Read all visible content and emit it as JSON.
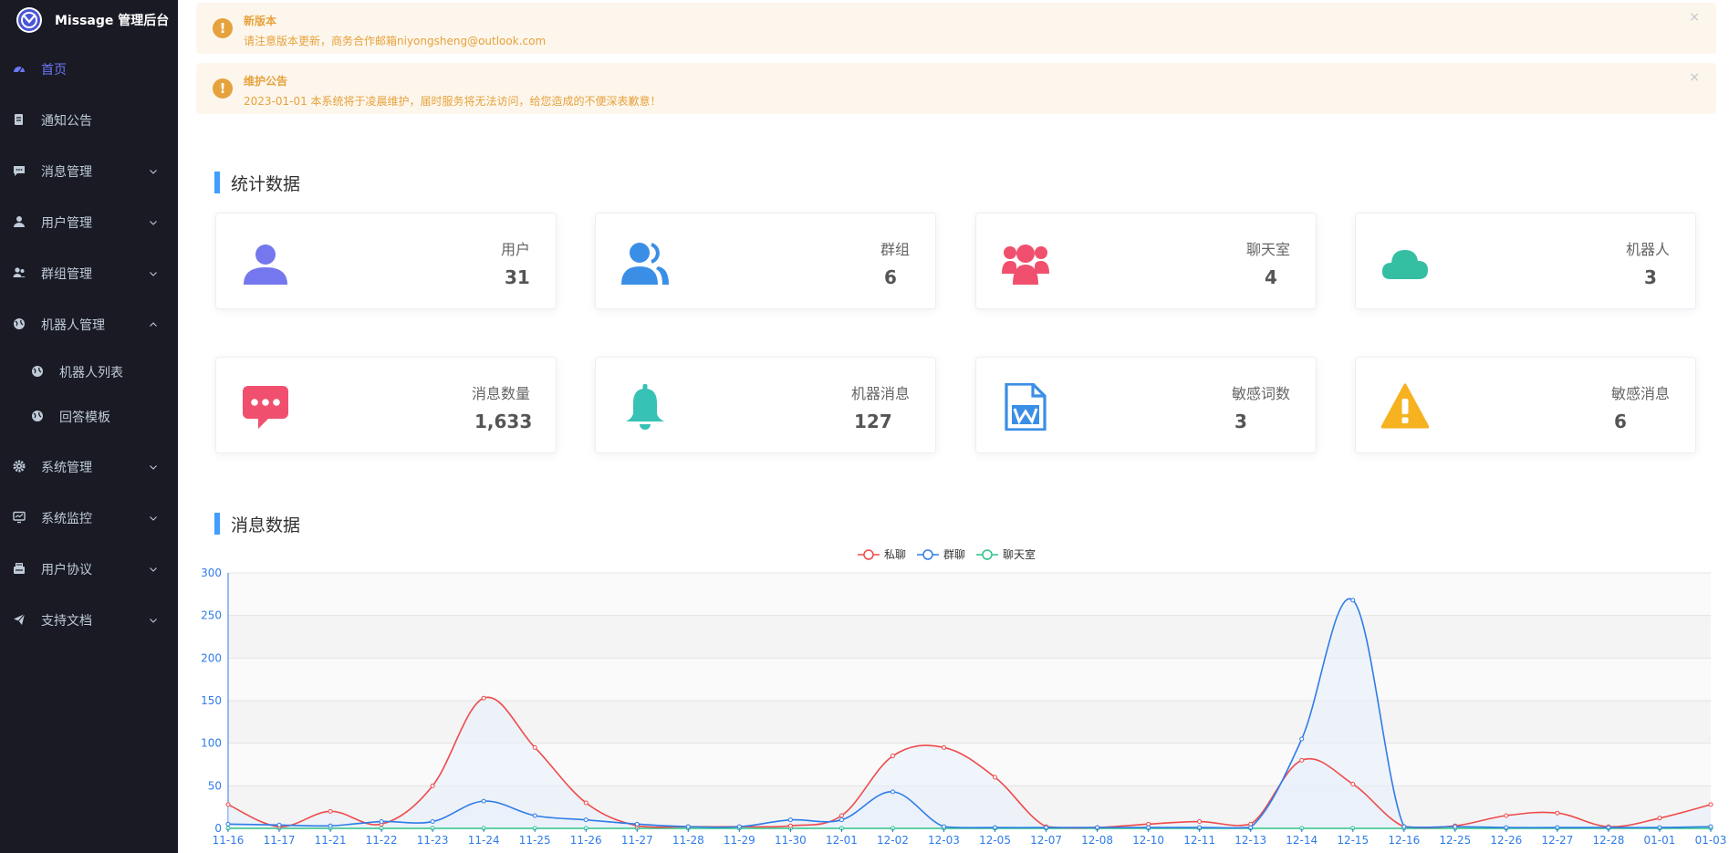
{
  "app": {
    "title": "Missage 管理后台"
  },
  "sidebar": {
    "items": [
      {
        "label": "首页",
        "icon": "dashboard-icon",
        "active": true
      },
      {
        "label": "通知公告",
        "icon": "notice-icon"
      },
      {
        "label": "消息管理",
        "icon": "message-icon",
        "expandable": true
      },
      {
        "label": "用户管理",
        "icon": "user-icon",
        "expandable": true
      },
      {
        "label": "群组管理",
        "icon": "group-icon",
        "expandable": true
      },
      {
        "label": "机器人管理",
        "icon": "globe-icon",
        "expandable": true,
        "expanded": true
      },
      {
        "label": "机器人列表",
        "icon": "globe-icon",
        "sub": true
      },
      {
        "label": "回答模板",
        "icon": "globe-icon",
        "sub": true
      },
      {
        "label": "系统管理",
        "icon": "gear-icon",
        "expandable": true
      },
      {
        "label": "系统监控",
        "icon": "monitor-icon",
        "expandable": true
      },
      {
        "label": "用户协议",
        "icon": "agreement-icon",
        "expandable": true
      },
      {
        "label": "支持文档",
        "icon": "paper-plane-icon",
        "expandable": true
      }
    ]
  },
  "alerts": [
    {
      "title": "新版本",
      "description": "请注意版本更新，商务合作邮箱niyongsheng@outlook.com",
      "close": "×"
    },
    {
      "title": "维护公告",
      "description": "2023-01-01 本系统将于凌晨维护，届时服务将无法访问，给您造成的不便深表歉意！",
      "close": "×"
    }
  ],
  "stats_section": {
    "title": "统计数据"
  },
  "stats": [
    {
      "label": "用户",
      "value": "31",
      "icon": "user-icon",
      "color": "#7577ee"
    },
    {
      "label": "群组",
      "value": "6",
      "icon": "users-icon",
      "color": "#3a8ee6"
    },
    {
      "label": "聊天室",
      "value": "4",
      "icon": "people-group-icon",
      "color": "#f0506e"
    },
    {
      "label": "机器人",
      "value": "3",
      "icon": "cloud-icon",
      "color": "#34bfa3"
    },
    {
      "label": "消息数量",
      "value": "1,633",
      "icon": "chat-bubble-icon",
      "color": "#f0506e"
    },
    {
      "label": "机器消息",
      "value": "127",
      "icon": "bell-icon",
      "color": "#36c2b4"
    },
    {
      "label": "敏感词数",
      "value": "3",
      "icon": "word-file-icon",
      "color": "#3a8ee6"
    },
    {
      "label": "敏感消息",
      "value": "6",
      "icon": "warning-icon",
      "color": "#f6b21f"
    }
  ],
  "messages_section": {
    "title": "消息数据"
  },
  "chart_data": {
    "type": "line",
    "categories": [
      "11-16",
      "11-17",
      "11-21",
      "11-22",
      "11-23",
      "11-24",
      "11-25",
      "11-26",
      "11-27",
      "11-28",
      "11-29",
      "11-30",
      "12-01",
      "12-02",
      "12-03",
      "12-05",
      "12-07",
      "12-08",
      "12-10",
      "12-11",
      "12-13",
      "12-14",
      "12-15",
      "12-16",
      "12-25",
      "12-26",
      "12-27",
      "12-28",
      "01-01",
      "01-03"
    ],
    "series": [
      {
        "name": "私聊",
        "color": "#ee4b4b",
        "values": [
          28,
          2,
          20,
          5,
          50,
          153,
          95,
          30,
          3,
          2,
          2,
          3,
          15,
          85,
          95,
          60,
          2,
          1,
          5,
          8,
          5,
          80,
          52,
          2,
          3,
          15,
          18,
          2,
          12,
          28
        ]
      },
      {
        "name": "群聊",
        "color": "#2f7ce8",
        "area": true,
        "values": [
          5,
          4,
          3,
          8,
          8,
          32,
          15,
          10,
          5,
          2,
          2,
          10,
          10,
          43,
          2,
          1,
          1,
          1,
          1,
          1,
          1,
          105,
          268,
          2,
          2,
          1,
          1,
          1,
          1,
          2
        ]
      },
      {
        "name": "聊天室",
        "color": "#2ec486",
        "values": [
          0,
          0,
          0,
          0,
          0,
          0,
          0,
          0,
          0,
          0,
          0,
          0,
          0,
          0,
          0,
          0,
          0,
          0,
          0,
          0,
          0,
          0,
          0,
          0,
          0,
          0,
          0,
          0,
          0,
          0
        ]
      }
    ],
    "y_ticks": [
      "0",
      "50",
      "100",
      "150",
      "200",
      "250",
      "300"
    ],
    "ylim": [
      0,
      300
    ],
    "legend": "top-center",
    "grid": true
  }
}
